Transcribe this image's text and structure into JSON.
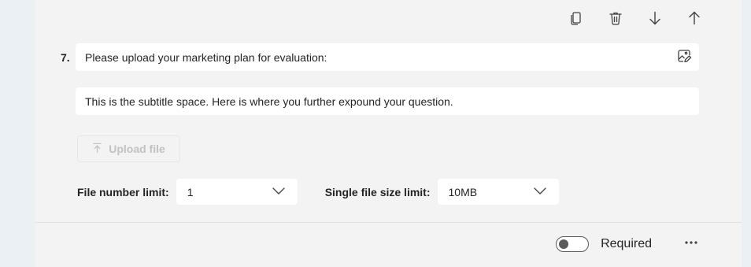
{
  "toolbar": {
    "copy_icon": "copy-icon",
    "delete_icon": "trash-icon",
    "move_down_icon": "arrow-down-icon",
    "move_up_icon": "arrow-up-icon"
  },
  "question": {
    "number": "7.",
    "title": "Please upload your marketing plan for evaluation:",
    "subtitle": "This is the subtitle space. Here is where you further expound your question."
  },
  "upload": {
    "label": "Upload file"
  },
  "limits": {
    "file_number_label": "File number limit:",
    "file_number_value": "1",
    "file_size_label": "Single file size limit:",
    "file_size_value": "10MB"
  },
  "footer": {
    "required_label": "Required",
    "required_on": false
  },
  "colors": {
    "card_bg": "#f3f3f3",
    "page_bg": "#eaf0f4",
    "text": "#252423",
    "disabled_text": "#c2c2c2"
  }
}
